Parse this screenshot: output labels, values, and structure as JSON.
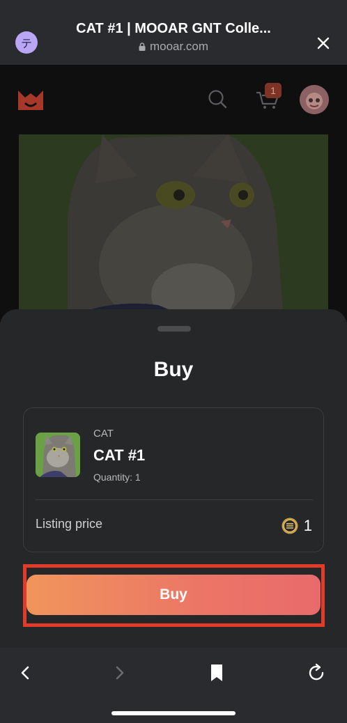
{
  "browser": {
    "site_initial": "テ",
    "page_title": "CAT #1 | MOOAR GNT Colle...",
    "url": "mooar.com"
  },
  "header": {
    "cart_count": "1"
  },
  "sheet": {
    "title": "Buy",
    "item": {
      "collection": "CAT",
      "name": "CAT #1",
      "quantity": "Quantity: 1"
    },
    "price_label": "Listing price",
    "price_value": "1",
    "buy_label": "Buy"
  },
  "colors": {
    "accent_start": "#f0955c",
    "accent_end": "#e96a6b",
    "highlight_outline": "#e33b2a",
    "badge": "#7d3326"
  },
  "icons": [
    "lock-icon",
    "close-icon",
    "logo-icon",
    "search-icon",
    "cart-icon",
    "coin-icon",
    "back-icon",
    "forward-icon",
    "bookmark-icon",
    "refresh-icon"
  ]
}
